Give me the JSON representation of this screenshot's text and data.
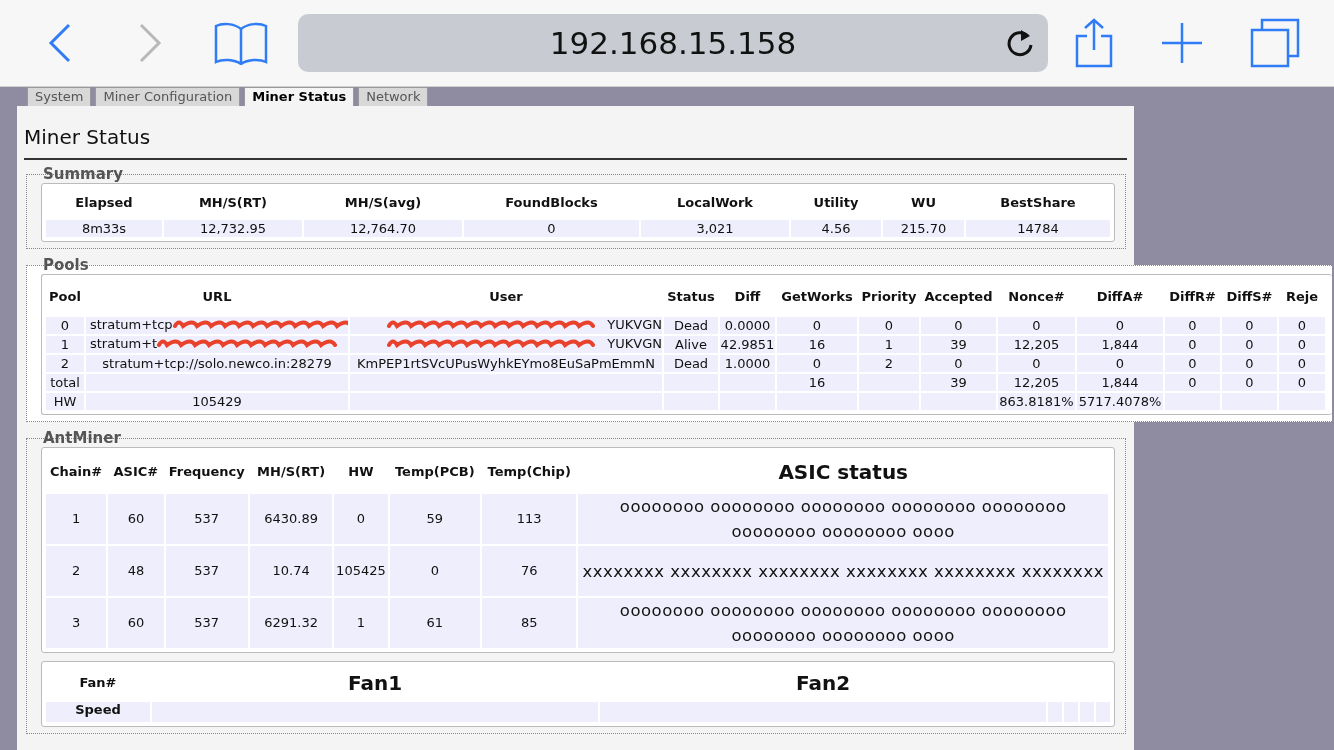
{
  "browser": {
    "address": "192.168.15.158"
  },
  "tabs": [
    {
      "label": "System",
      "selected": false
    },
    {
      "label": "Miner Configuration",
      "selected": false
    },
    {
      "label": "Miner Status",
      "selected": true
    },
    {
      "label": "Network",
      "selected": false
    }
  ],
  "page_title": "Miner Status",
  "summary": {
    "legend": "Summary",
    "columns": [
      "Elapsed",
      "MH/S(RT)",
      "MH/S(avg)",
      "FoundBlocks",
      "LocalWork",
      "Utility",
      "WU",
      "BestShare"
    ],
    "rows": [
      [
        "8m33s",
        "12,732.95",
        "12,764.70",
        "0",
        "3,021",
        "4.56",
        "215.70",
        "14784"
      ]
    ]
  },
  "pools": {
    "legend": "Pools",
    "columns": [
      "Pool",
      "URL",
      "User",
      "Status",
      "Diff",
      "GetWorks",
      "Priority",
      "Accepted",
      "Nonce#",
      "DiffA#",
      "DiffR#",
      "DiffS#",
      "Reje"
    ],
    "rows": [
      {
        "redacted": true,
        "cells": [
          "0",
          "stratum+tcp",
          "YUKVGN",
          "Dead",
          "0.0000",
          "0",
          "0",
          "0",
          "0",
          "0",
          "0",
          "0",
          "0"
        ]
      },
      {
        "redacted": true,
        "cells": [
          "1",
          "stratum+t",
          "YUKVGN",
          "Alive",
          "42.9851",
          "16",
          "1",
          "39",
          "12,205",
          "1,844",
          "0",
          "0",
          "0"
        ]
      },
      {
        "redacted": false,
        "cells": [
          "2",
          "stratum+tcp://solo.newco.in:28279",
          "KmPEP1rtSVcUPusWyhkEYmo8EuSaPmEmmN",
          "Dead",
          "1.0000",
          "0",
          "2",
          "0",
          "0",
          "0",
          "0",
          "0",
          "0"
        ]
      },
      {
        "redacted": false,
        "cells": [
          "total",
          null,
          null,
          null,
          null,
          "16",
          null,
          "39",
          "12,205",
          "1,844",
          "0",
          "0",
          "0"
        ]
      },
      {
        "redacted": false,
        "cells": [
          "HW",
          "105429",
          null,
          null,
          null,
          null,
          null,
          null,
          "863.8181%",
          "5717.4078%",
          null,
          null,
          null
        ]
      }
    ]
  },
  "antminer": {
    "legend": "AntMiner",
    "columns": [
      "Chain#",
      "ASIC#",
      "Frequency",
      "MH/S(RT)",
      "HW",
      "Temp(PCB)",
      "Temp(Chip)",
      "ASIC status"
    ],
    "rows": [
      [
        "1",
        "60",
        "537",
        "6430.89",
        "0",
        "59",
        "113",
        "oooooooo oooooooo oooooooo oooooooo oooooooo oooooooo oooooooo oooo"
      ],
      [
        "2",
        "48",
        "537",
        "10.74",
        "105425",
        "0",
        "76",
        "xxxxxxxx xxxxxxxx xxxxxxxx xxxxxxxx xxxxxxxx xxxxxxxx"
      ],
      [
        "3",
        "60",
        "537",
        "6291.32",
        "1",
        "61",
        "85",
        "oooooooo oooooooo oooooooo oooooooo oooooooo oooooooo oooooooo oooo"
      ]
    ]
  },
  "fans": {
    "columns": [
      "Fan#",
      "Fan1",
      "Fan2"
    ],
    "row_label": "Speed"
  }
}
